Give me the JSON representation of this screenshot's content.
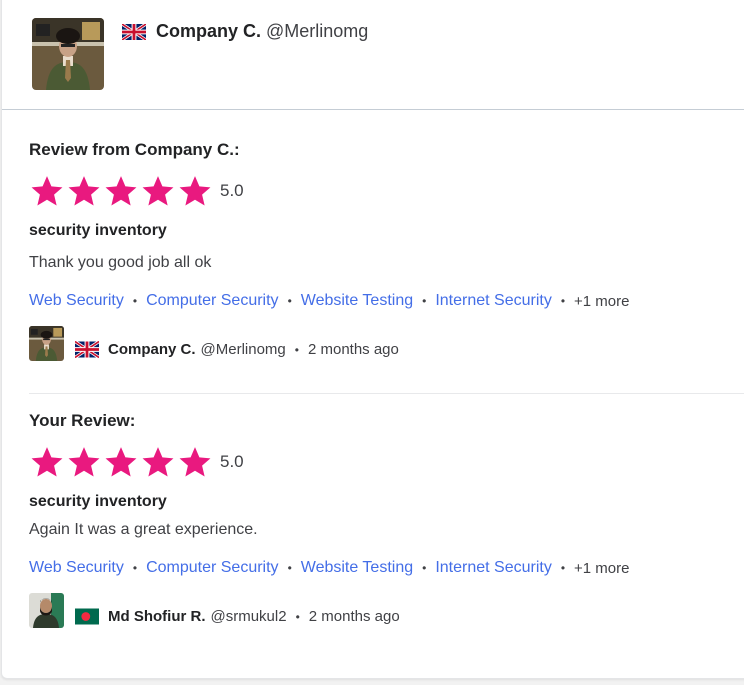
{
  "header": {
    "flag": "united-kingdom-flag",
    "name": "Company C.",
    "handle": "@Merlinomg"
  },
  "reviews": [
    {
      "title": "Review from Company C.:",
      "rating": 5,
      "rating_label": "5.0",
      "subject": "security inventory",
      "text": "Thank you good job all ok",
      "tags": [
        "Web Security",
        "Computer Security",
        "Website Testing",
        "Internet Security"
      ],
      "more": "+1 more",
      "author": {
        "flag": "united-kingdom-flag",
        "name": "Company C.",
        "handle": "@Merlinomg",
        "time": "2 months ago"
      }
    },
    {
      "title": "Your Review:",
      "rating": 5,
      "rating_label": "5.0",
      "subject": "security inventory",
      "text": "Again It was a great experience.",
      "tags": [
        "Web Security",
        "Computer Security",
        "Website Testing",
        "Internet Security"
      ],
      "more": "+1 more",
      "author": {
        "flag": "bangladesh-flag",
        "name": "Md Shofiur R.",
        "handle": "@srmukul2",
        "time": "2 months ago"
      }
    }
  ],
  "colors": {
    "star": "#e9197f",
    "link": "#446ee7",
    "text": "#222325",
    "muted": "#404145"
  },
  "separator": "•"
}
